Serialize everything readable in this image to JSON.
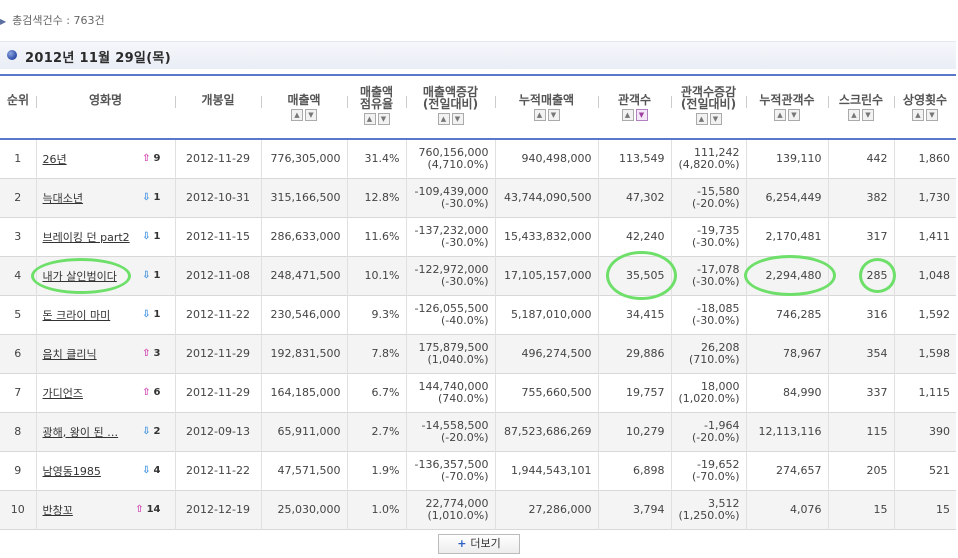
{
  "summary": {
    "total_label": "총검색건수 : 763건"
  },
  "date_header": "2012년 11월 29일(목)",
  "columns": {
    "rank": "순위",
    "title": "영화명",
    "open_date": "개봉일",
    "sales_l1": "매출액",
    "share_l1": "매출액",
    "share_l2": "점유율",
    "sales_change_l1": "매출액증감",
    "sales_change_l2": "(전일대비)",
    "cum_sales": "누적매출액",
    "audience": "관객수",
    "aud_change_l1": "관객수증감",
    "aud_change_l2": "(전일대비)",
    "cum_audience": "누적관객수",
    "screens": "스크린수",
    "shows": "상영횟수"
  },
  "sort_icons": {
    "up": "▲",
    "down": "▼"
  },
  "rows": [
    {
      "rank": "1",
      "title": "26년",
      "dir": "up",
      "delta": "9",
      "open": "2012-11-29",
      "sales": "776,305,000",
      "share": "31.4%",
      "sc1": "760,156,000",
      "sc2": "(4,710.0%)",
      "cum_sales": "940,498,000",
      "aud": "113,549",
      "ac1": "111,242",
      "ac2": "(4,820.0%)",
      "cum_aud": "139,110",
      "screens": "442",
      "shows": "1,860"
    },
    {
      "rank": "2",
      "title": "늑대소년",
      "dir": "down",
      "delta": "1",
      "open": "2012-10-31",
      "sales": "315,166,500",
      "share": "12.8%",
      "sc1": "-109,439,000",
      "sc2": "(-30.0%)",
      "cum_sales": "43,744,090,500",
      "aud": "47,302",
      "ac1": "-15,580",
      "ac2": "(-20.0%)",
      "cum_aud": "6,254,449",
      "screens": "382",
      "shows": "1,730"
    },
    {
      "rank": "3",
      "title": "브레이킹 던 part2",
      "dir": "down",
      "delta": "1",
      "open": "2012-11-15",
      "sales": "286,633,000",
      "share": "11.6%",
      "sc1": "-137,232,000",
      "sc2": "(-30.0%)",
      "cum_sales": "15,433,832,000",
      "aud": "42,240",
      "ac1": "-19,735",
      "ac2": "(-30.0%)",
      "cum_aud": "2,170,481",
      "screens": "317",
      "shows": "1,411"
    },
    {
      "rank": "4",
      "title": "내가 살인범이다",
      "dir": "down",
      "delta": "1",
      "open": "2012-11-08",
      "sales": "248,471,500",
      "share": "10.1%",
      "sc1": "-122,972,000",
      "sc2": "(-30.0%)",
      "cum_sales": "17,105,157,000",
      "aud": "35,505",
      "ac1": "-17,078",
      "ac2": "(-30.0%)",
      "cum_aud": "2,294,480",
      "screens": "285",
      "shows": "1,048"
    },
    {
      "rank": "5",
      "title": "돈 크라이 마미",
      "dir": "down",
      "delta": "1",
      "open": "2012-11-22",
      "sales": "230,546,000",
      "share": "9.3%",
      "sc1": "-126,055,500",
      "sc2": "(-40.0%)",
      "cum_sales": "5,187,010,000",
      "aud": "34,415",
      "ac1": "-18,085",
      "ac2": "(-30.0%)",
      "cum_aud": "746,285",
      "screens": "316",
      "shows": "1,592"
    },
    {
      "rank": "6",
      "title": "음치 클리닉",
      "dir": "up",
      "delta": "3",
      "open": "2012-11-29",
      "sales": "192,831,500",
      "share": "7.8%",
      "sc1": "175,879,500",
      "sc2": "(1,040.0%)",
      "cum_sales": "496,274,500",
      "aud": "29,886",
      "ac1": "26,208",
      "ac2": "(710.0%)",
      "cum_aud": "78,967",
      "screens": "354",
      "shows": "1,598"
    },
    {
      "rank": "7",
      "title": "가디언즈",
      "dir": "up",
      "delta": "6",
      "open": "2012-11-29",
      "sales": "164,185,000",
      "share": "6.7%",
      "sc1": "144,740,000",
      "sc2": "(740.0%)",
      "cum_sales": "755,660,500",
      "aud": "19,757",
      "ac1": "18,000",
      "ac2": "(1,020.0%)",
      "cum_aud": "84,990",
      "screens": "337",
      "shows": "1,115"
    },
    {
      "rank": "8",
      "title": "광해, 왕이 된 …",
      "dir": "down",
      "delta": "2",
      "open": "2012-09-13",
      "sales": "65,911,000",
      "share": "2.7%",
      "sc1": "-14,558,500",
      "sc2": "(-20.0%)",
      "cum_sales": "87,523,686,269",
      "aud": "10,279",
      "ac1": "-1,964",
      "ac2": "(-20.0%)",
      "cum_aud": "12,113,116",
      "screens": "115",
      "shows": "390"
    },
    {
      "rank": "9",
      "title": "남영동1985",
      "dir": "down",
      "delta": "4",
      "open": "2012-11-22",
      "sales": "47,571,500",
      "share": "1.9%",
      "sc1": "-136,357,500",
      "sc2": "(-70.0%)",
      "cum_sales": "1,944,543,101",
      "aud": "6,898",
      "ac1": "-19,652",
      "ac2": "(-70.0%)",
      "cum_aud": "274,657",
      "screens": "205",
      "shows": "521"
    },
    {
      "rank": "10",
      "title": "반창꼬",
      "dir": "up",
      "delta": "14",
      "open": "2012-12-19",
      "sales": "25,030,000",
      "share": "1.0%",
      "sc1": "22,774,000",
      "sc2": "(1,010.0%)",
      "cum_sales": "27,286,000",
      "aud": "3,794",
      "ac1": "3,512",
      "ac2": "(1,250.0%)",
      "cum_aud": "4,076",
      "screens": "15",
      "shows": "15"
    }
  ],
  "more_button": {
    "plus": "+",
    "label": "더보기"
  },
  "highlight_color": "#6ee06a"
}
